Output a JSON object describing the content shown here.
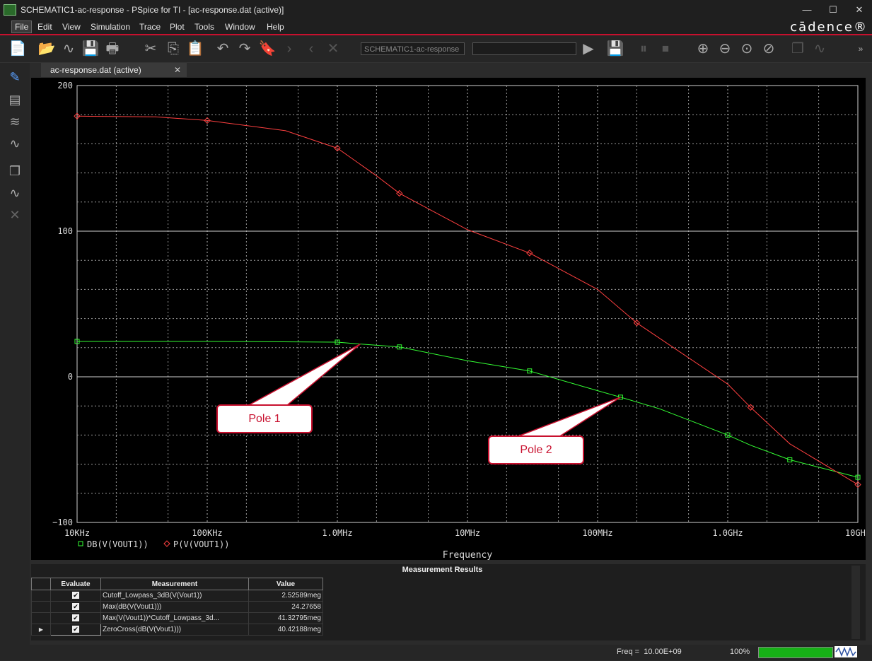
{
  "window": {
    "title": "SCHEMATIC1-ac-response - PSpice for TI - [ac-response.dat (active)]",
    "minimize": "—",
    "maximize": "☐",
    "close": "✕"
  },
  "menu": {
    "items": [
      "File",
      "Edit",
      "View",
      "Simulation",
      "Trace",
      "Plot",
      "Tools",
      "Window",
      "Help"
    ],
    "brand": "cādence®"
  },
  "toolbar": {
    "profile_field": "SCHEMATIC1-ac-response"
  },
  "tab": {
    "label": "ac-response.dat (active)",
    "close": "✕"
  },
  "chart_data": {
    "type": "line",
    "x_scale": "log",
    "xlim_hz": [
      10000,
      10000000000
    ],
    "ylim": [
      -100,
      200
    ],
    "grid": true,
    "y_ticks": [
      "200",
      "100",
      "0",
      "−100"
    ],
    "x_ticks": [
      "10KHz",
      "100KHz",
      "1.0MHz",
      "10MHz",
      "100MHz",
      "1.0GHz",
      "10GHz"
    ],
    "xlabel": "Frequency",
    "series": [
      {
        "name": "DB(V(VOUT1))",
        "color": "#33ff33",
        "marker": "square",
        "x_hz": [
          10000,
          100000,
          1000000,
          1500000,
          3000000,
          10000000,
          30000000,
          100000000,
          150000000,
          300000000,
          1000000000,
          1500000000,
          3000000000,
          10000000000
        ],
        "y": [
          24.3,
          24.3,
          23.8,
          22.5,
          20.5,
          11,
          4,
          -9.5,
          -14,
          -22,
          -40,
          -47,
          -57,
          -69
        ]
      },
      {
        "name": "P(V(VOUT1))",
        "color": "#ff4040",
        "marker": "diamond",
        "x_hz": [
          10000,
          40000,
          100000,
          400000,
          1000000,
          2000000,
          3000000,
          10000000,
          30000000,
          100000000,
          200000000,
          1000000000,
          1500000000,
          3000000000,
          10000000000
        ],
        "y": [
          179,
          178.5,
          176,
          169,
          157,
          138,
          126,
          101,
          85,
          60,
          37,
          -5,
          -21,
          -46,
          -74
        ]
      }
    ],
    "annotations": [
      "Pole 1",
      "Pole 2"
    ]
  },
  "measurements": {
    "title": "Measurement Results",
    "headers": [
      "Evaluate",
      "Measurement",
      "Value"
    ],
    "rows": [
      {
        "measurement": "Cutoff_Lowpass_3dB(V(Vout1))",
        "value": "2.52589meg",
        "checked": "✔"
      },
      {
        "measurement": "Max(dB(V(Vout1)))",
        "value": "24.27658",
        "checked": "✔"
      },
      {
        "measurement": "Max(V(Vout1))*Cutoff_Lowpass_3d...",
        "value": "41.32795meg",
        "checked": "✔"
      },
      {
        "measurement": "ZeroCross(dB(V(Vout1)))",
        "value": "40.42188meg",
        "checked": "✔"
      }
    ]
  },
  "status": {
    "freq_label": "Freq =",
    "freq_value": "10.00E+09",
    "zoom": "100%",
    "progress_fraction": 1.0
  }
}
